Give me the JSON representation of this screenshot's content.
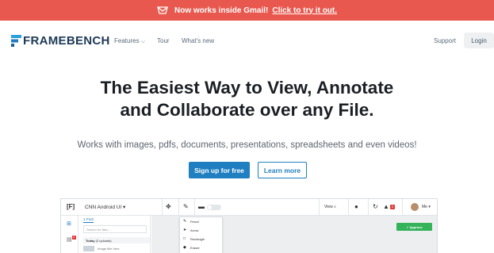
{
  "banner": {
    "message": "Now works inside Gmail!",
    "link": "Click to try it out.",
    "icon": "gmail-envelope-icon",
    "color": "#e8584e"
  },
  "nav": {
    "logo_text": "FRAMEBENCH",
    "links": [
      {
        "label": "Features",
        "has_caret": true
      },
      {
        "label": "Tour"
      },
      {
        "label": "What's new"
      }
    ],
    "support": "Support",
    "login": "Login"
  },
  "hero": {
    "headline_line1": "The Easiest Way to View, Annotate",
    "headline_line2": "and Collaborate over any File.",
    "subline": "Works with images, pdfs, documents, presentations, spreadsheets and even videos!",
    "primary_cta": "Sign up for free",
    "secondary_cta": "Learn more",
    "accent": "#1f7fc0"
  },
  "preview": {
    "brand": "[F]",
    "file_name": "CNN Android UI ▾",
    "view_label": "View",
    "badge_count": "2",
    "me_label": "Me ▾",
    "panel_tab": "1 FILE",
    "search_placeholder": "Search for files...",
    "date_group": "Today",
    "date_group_detail": "(3 uploads)",
    "file_row_label": "Image title here",
    "tools": [
      "Pencil",
      "Arrow",
      "Rectangle",
      "Eraser"
    ],
    "approve": "✓ Approve",
    "rail_badge": "2"
  }
}
